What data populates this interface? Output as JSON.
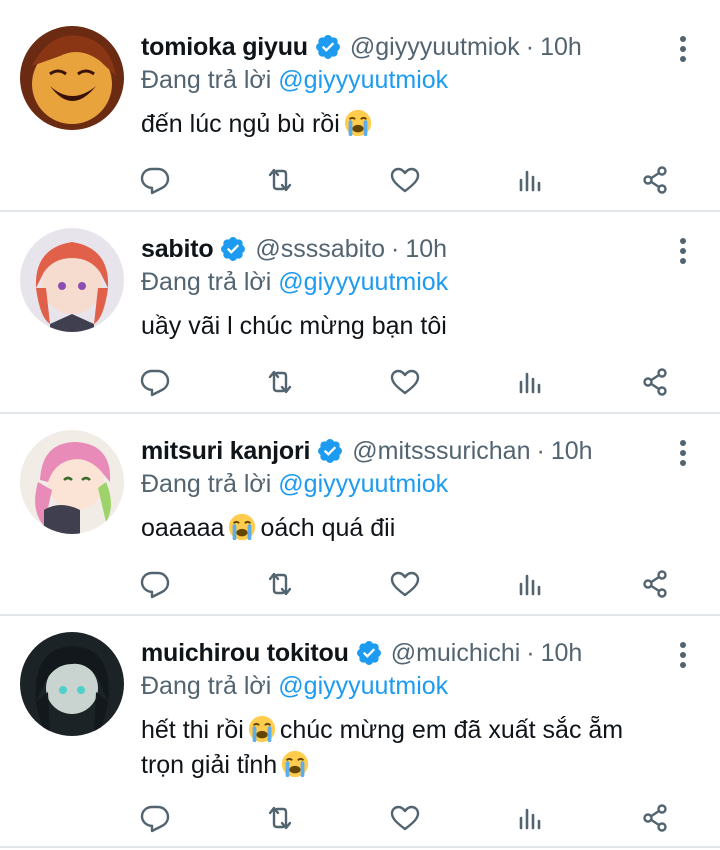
{
  "reply_prefix": "Đang trả lời",
  "more_icon": "more-vertical-icon",
  "action_icons": [
    "reply-icon",
    "retweet-icon",
    "like-icon",
    "views-icon",
    "share-icon"
  ],
  "colors": {
    "text": "#0f1419",
    "secondary": "#536471",
    "accent": "#1d9bf0",
    "divider": "#e1e6ea"
  },
  "tweets": [
    {
      "name": "tomioka giyuu",
      "handle": "@giyyyuutmiok",
      "time": "10h",
      "mention": "@giyyyuutmiok",
      "text1": "đến lúc ngủ bù rồi",
      "emoji1": "loudly-crying-face",
      "text2": "",
      "emoji2": "",
      "text3": ""
    },
    {
      "name": "sabito",
      "handle": "@ssssabito",
      "time": "10h",
      "mention": "@giyyyuutmiok",
      "text1": "uầy vãi l chúc mừng bạn tôi",
      "emoji1": "",
      "text2": "",
      "emoji2": "",
      "text3": ""
    },
    {
      "name": "mitsuri kanjori",
      "handle": "@mitsssurichan",
      "time": "10h",
      "mention": "@giyyyuutmiok",
      "text1": "oaaaaa",
      "emoji1": "loudly-crying-face",
      "text2": "oách quá đii",
      "emoji2": "",
      "text3": ""
    },
    {
      "name": "muichirou tokitou",
      "handle": "@muichichi",
      "time": "10h",
      "mention": "@giyyyuutmiok",
      "text1": "hết thi rồi",
      "emoji1": "loudly-crying-face",
      "text2": "chúc mừng em đã xuất sắc ẵm trọn giải tỉnh",
      "emoji2": "loudly-crying-face",
      "text3": ""
    }
  ]
}
